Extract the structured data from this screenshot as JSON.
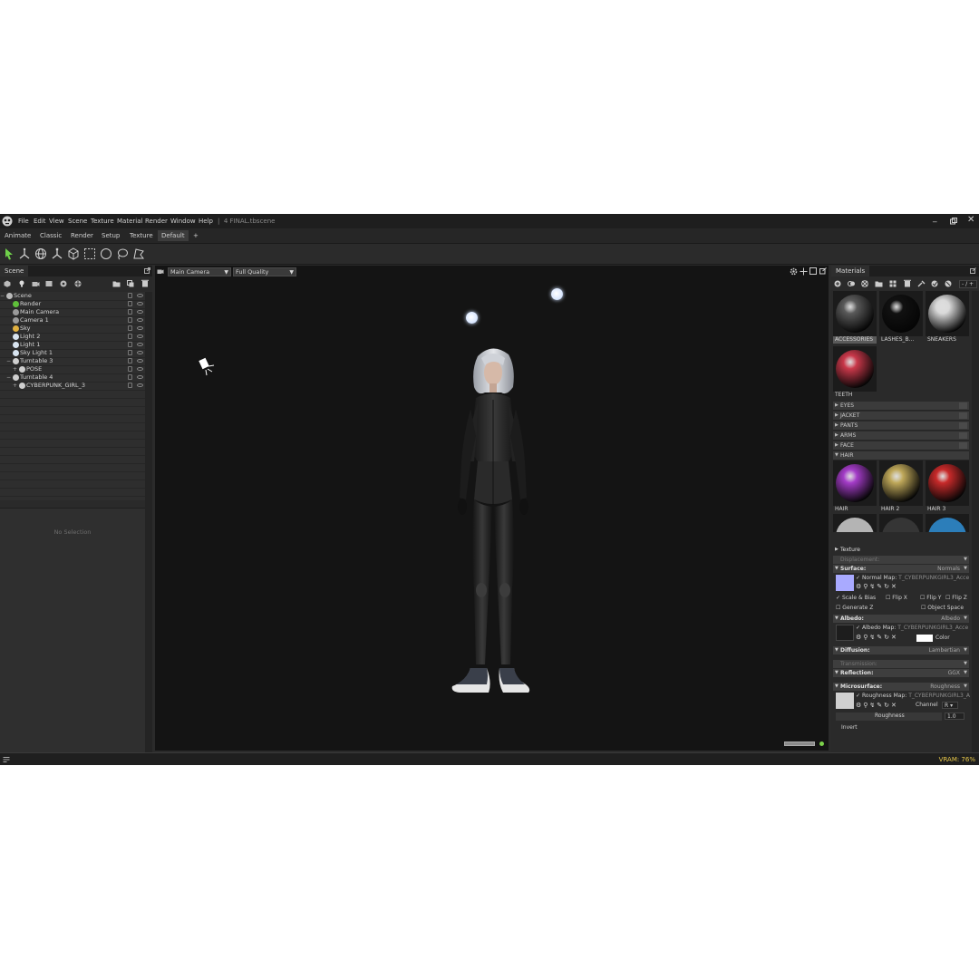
{
  "menubar": {
    "items": [
      "File",
      "Edit",
      "View",
      "Scene",
      "Texture",
      "Material",
      "Render",
      "Window",
      "Help"
    ],
    "title": "4 FINAL.tbscene",
    "separator": "|"
  },
  "tabs": {
    "items": [
      "Animate",
      "Classic",
      "Render",
      "Setup",
      "Texture",
      "Default"
    ],
    "active": "Default",
    "add": "+"
  },
  "scene": {
    "panel_title": "Scene",
    "tree": [
      {
        "label": "Scene",
        "indent": 0,
        "icon_color": "#bbbbbb",
        "toggle": "−"
      },
      {
        "label": "Render",
        "indent": 1,
        "icon_color": "#5fbf3a"
      },
      {
        "label": "Main Camera",
        "indent": 1,
        "icon_color": "#9a9a9a"
      },
      {
        "label": "Camera 1",
        "indent": 1,
        "icon_color": "#9a9a9a"
      },
      {
        "label": "Sky",
        "indent": 1,
        "icon_color": "#e0b040"
      },
      {
        "label": "Light 2",
        "indent": 1,
        "icon_color": "#d8e4f0"
      },
      {
        "label": "Light 1",
        "indent": 1,
        "icon_color": "#d8e4f0"
      },
      {
        "label": "Sky Light 1",
        "indent": 1,
        "icon_color": "#d8e4f0"
      },
      {
        "label": "Turntable 3",
        "indent": 1,
        "icon_color": "#cfcfcf",
        "toggle": "−"
      },
      {
        "label": "POSE",
        "indent": 2,
        "icon_color": "#cfcfcf",
        "toggle": "+"
      },
      {
        "label": "Turntable 4",
        "indent": 1,
        "icon_color": "#cfcfcf",
        "toggle": "−"
      },
      {
        "label": "CYBERPUNK_GIRL_3",
        "indent": 2,
        "icon_color": "#cfcfcf",
        "toggle": "+"
      }
    ],
    "no_selection": "No Selection"
  },
  "viewport": {
    "camera": "Main Camera",
    "quality": "Full Quality"
  },
  "materials": {
    "panel_title": "Materials",
    "search": "- / +",
    "thumbs": [
      {
        "label": "ACCESSORIES",
        "selected": true,
        "color": "#5a5a5a"
      },
      {
        "label": "LASHES_B...",
        "selected": false,
        "color": "#111111"
      },
      {
        "label": "SNEAKERS",
        "selected": false,
        "color": "#d9d9d9"
      },
      {
        "label": "TEETH",
        "selected": false,
        "color": "#c9384a"
      }
    ],
    "groups": [
      "EYES",
      "JACKET",
      "PANTS",
      "ARMS",
      "FACE"
    ],
    "hair_group": "HAIR",
    "hair_thumbs": [
      {
        "label": "HAIR",
        "color": "#a43cc8"
      },
      {
        "label": "HAIR 2",
        "color": "#bfa85a"
      },
      {
        "label": "HAIR 3",
        "color": "#c82a2a"
      }
    ],
    "hair_row2_colors": [
      "#cfcfcf",
      "#3a3a3a",
      "#2f8fd6"
    ]
  },
  "props": {
    "texture": "Texture",
    "displacement": {
      "label": "Displacement:"
    },
    "surface": {
      "label": "Surface:",
      "value": "Normals"
    },
    "normal_map": {
      "label": "Normal Map:",
      "file": "T_CYBERPUNKGIRL3_Acce"
    },
    "scale_bias": "Scale & Bias",
    "flip_x": "Flip X",
    "flip_y": "Flip Y",
    "flip_z": "Flip Z",
    "generate_z": "Generate Z",
    "object_space": "Object Space",
    "albedo": {
      "label": "Albedo:",
      "value": "Albedo"
    },
    "albedo_map": {
      "label": "Albedo Map:",
      "file": "T_CYBERPUNKGIRL3_Acce"
    },
    "color_label": "Color",
    "diffusion": {
      "label": "Diffusion:",
      "value": "Lambertian"
    },
    "transmission": {
      "label": "Transmission:"
    },
    "reflection": {
      "label": "Reflection:",
      "value": "GGX"
    },
    "microsurface": {
      "label": "Microsurface:",
      "value": "Roughness"
    },
    "roughness_map": {
      "label": "Roughness Map:",
      "file": "T_CYBERPUNKGIRL3_A"
    },
    "channel_label": "Channel",
    "channel_value": "R",
    "roughness_label": "Roughness",
    "roughness_value": "1.0",
    "invert": "Invert"
  },
  "status": {
    "vram": "VRAM: 76%"
  },
  "colors": {
    "normal_swatch": "#a9aaff",
    "albedo_swatch": "#1d1d1d",
    "roughness_swatch": "#d0d0d0",
    "accent_green": "#7cd14a",
    "vram_text": "#e8c84a"
  }
}
